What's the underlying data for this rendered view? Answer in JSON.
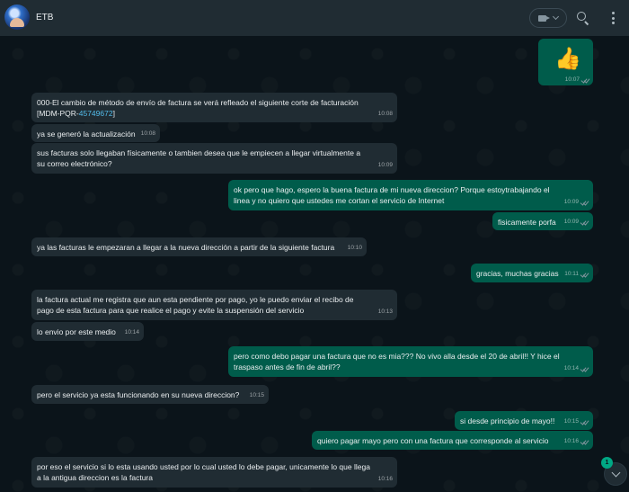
{
  "header": {
    "contact_name": "ETB"
  },
  "chat": {
    "sticker": {
      "emoji": "👍",
      "time": "10:07",
      "status": "read"
    },
    "messages": [
      {
        "dir": "in",
        "text_a": "000-El cambio de método de envío de factura se verá refleado el siguiente corte de facturación",
        "text_b": "[MDM-PQR-",
        "link": "45749672",
        "text_c": "]",
        "time": "10:08"
      },
      {
        "dir": "in",
        "text": "ya se generó la actualización",
        "time": "10:08"
      },
      {
        "dir": "in",
        "text": "sus facturas solo llegaban físicamente o tambien desea que le empiecen a llegar virtualmente a su correo electrónico?",
        "time": "10:09"
      },
      {
        "dir": "out",
        "text": "ok pero que hago, espero la buena factura de mi nueva direccion? Porque estoytrabajando el linea y no quiero que ustedes me cortan el servicio de Internet",
        "time": "10:09"
      },
      {
        "dir": "out",
        "text": "fisicamente porfa",
        "time": "10:09"
      },
      {
        "dir": "in",
        "text": "ya las facturas le empezaran a llegar a la nueva dirección a partir de la siguiente factura",
        "time": "10:10"
      },
      {
        "dir": "out",
        "text": "gracias, muchas gracias",
        "time": "10:11"
      },
      {
        "dir": "in",
        "text": "la factura actual me registra que aun esta pendiente por pago, yo le puedo enviar el recibo de pago de esta factura para que realice el pago y evite la suspensión del servicio",
        "time": "10:13"
      },
      {
        "dir": "in",
        "text": "lo envio por este medio",
        "time": "10:14"
      },
      {
        "dir": "out",
        "text": "pero como debo pagar una factura que no es mia??? No vivo alla desde el 20 de abril!! Y hice el traspaso antes de fin de abril??",
        "time": "10:14"
      },
      {
        "dir": "in",
        "text": "pero el servicio ya esta funcionando en su nueva direccion?",
        "time": "10:15"
      },
      {
        "dir": "out",
        "text": "si desde principio de mayo!!",
        "time": "10:15"
      },
      {
        "dir": "out",
        "text": "quiero pagar mayo pero con una factura que corresponde al servicio",
        "time": "10:16"
      },
      {
        "dir": "in",
        "text": "por eso el servicio si lo esta usando usted por lo cual usted lo debe pagar, unicamente lo que llega a la antigua direccion es la factura",
        "time": "10:16"
      }
    ],
    "unread_count": "1"
  },
  "icons": {
    "video": "video-camera-icon",
    "search": "search-icon",
    "menu": "kebab-menu-icon",
    "scroll": "chevron-down-icon",
    "ticks": "double-check-icon"
  },
  "colors": {
    "header_bg": "#202c33",
    "chat_bg": "#0b141a",
    "incoming_bubble": "#202c33",
    "outgoing_bubble": "#005c4b",
    "link": "#53bdeb",
    "badge": "#00a884"
  }
}
